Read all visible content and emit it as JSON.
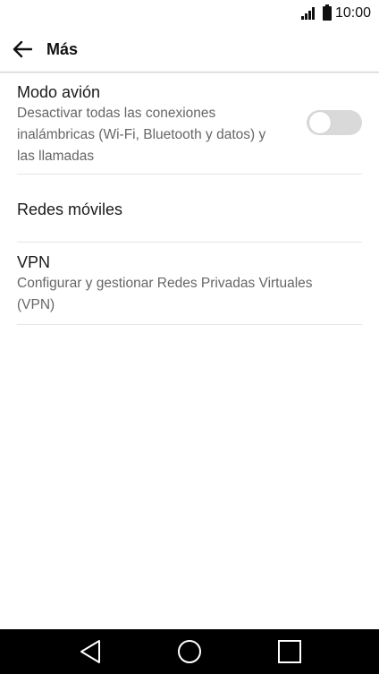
{
  "status_bar": {
    "time": "10:00",
    "signal_icon": "signal-icon",
    "battery_icon": "battery-icon"
  },
  "app_bar": {
    "title": "Más",
    "back_icon": "arrow-left-icon"
  },
  "settings": {
    "airplane_mode": {
      "title": "Modo avión",
      "subtitle": "Desactivar todas las conexiones inalámbricas (Wi-Fi, Bluetooth y datos) y las llamadas",
      "toggle_state": "off"
    },
    "mobile_networks": {
      "title": "Redes móviles"
    },
    "vpn": {
      "title": "VPN",
      "subtitle": "Configurar y gestionar Redes Privadas Virtuales (VPN)"
    }
  },
  "nav_bar": {
    "back_icon": "triangle-back-icon",
    "home_icon": "circle-home-icon",
    "recents_icon": "square-recents-icon"
  },
  "colors": {
    "background": "#ffffff",
    "nav_bar": "#000000",
    "toggle_off_track": "#d9d9d9",
    "subtitle_text": "#666666"
  }
}
